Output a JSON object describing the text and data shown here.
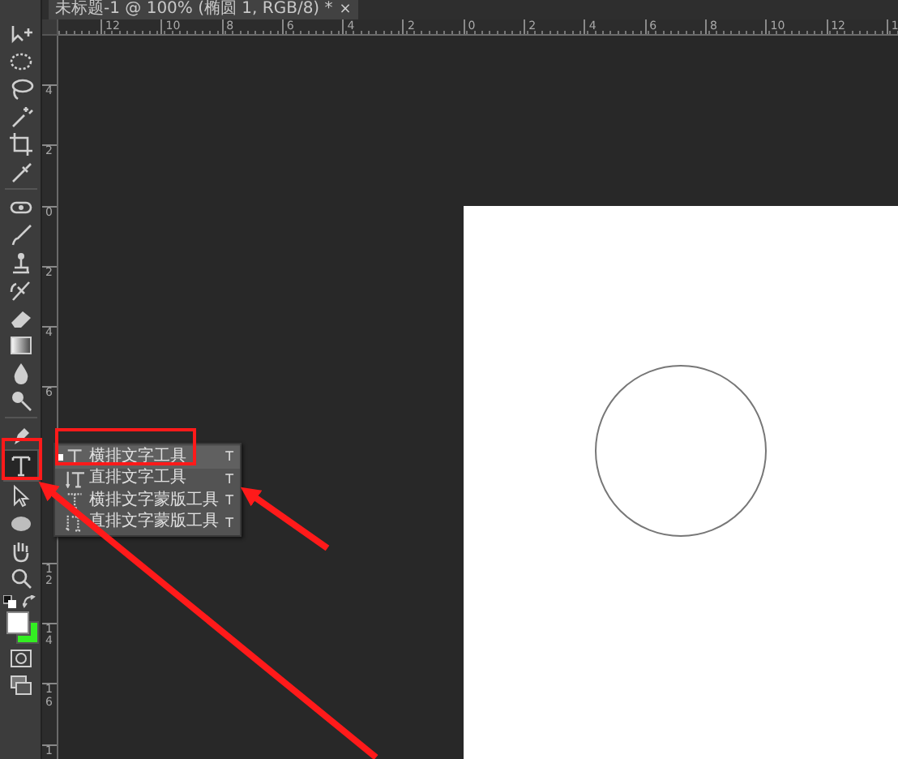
{
  "document_tab": {
    "title": "未标题-1 @ 100% (椭圆 1, RGB/8) *",
    "close": "×"
  },
  "toolbar": {
    "tools": [
      {
        "selected": false
      },
      {
        "selected": false
      },
      {
        "selected": false
      },
      {
        "selected": false
      },
      {
        "selected": false
      },
      {
        "selected": false
      },
      {
        "selected": false
      },
      {
        "selected": false
      },
      {
        "selected": false
      },
      {
        "selected": false
      },
      {
        "selected": false
      },
      {
        "selected": false
      },
      {
        "selected": false
      },
      {
        "selected": false
      },
      {
        "selected": false
      },
      {
        "selected": true
      },
      {
        "selected": false
      },
      {
        "selected": false
      },
      {
        "selected": false
      },
      {
        "selected": false
      }
    ],
    "foreground": {
      "color": "#ffffff"
    },
    "background": {
      "color": "#33ee22"
    }
  },
  "horizontal_ruler": [
    "12",
    "10",
    "8",
    "6",
    "4",
    "2",
    "0",
    "2",
    "4",
    "6",
    "8",
    "10",
    "12",
    "1"
  ],
  "vertical_ruler": {
    "upper": [
      "4",
      "2",
      "0",
      "2",
      "4",
      "6"
    ],
    "lower": [
      "12",
      "14",
      "16",
      "1"
    ]
  },
  "flyout": {
    "items": [
      {
        "label": "横排文字工具",
        "shortcut": "T",
        "selected": true
      },
      {
        "label": "直排文字工具",
        "shortcut": "T",
        "selected": false
      },
      {
        "label": "横排文字蒙版工具",
        "shortcut": "T",
        "selected": false
      },
      {
        "label": "直排文字蒙版工具",
        "shortcut": "T",
        "selected": false
      }
    ]
  }
}
